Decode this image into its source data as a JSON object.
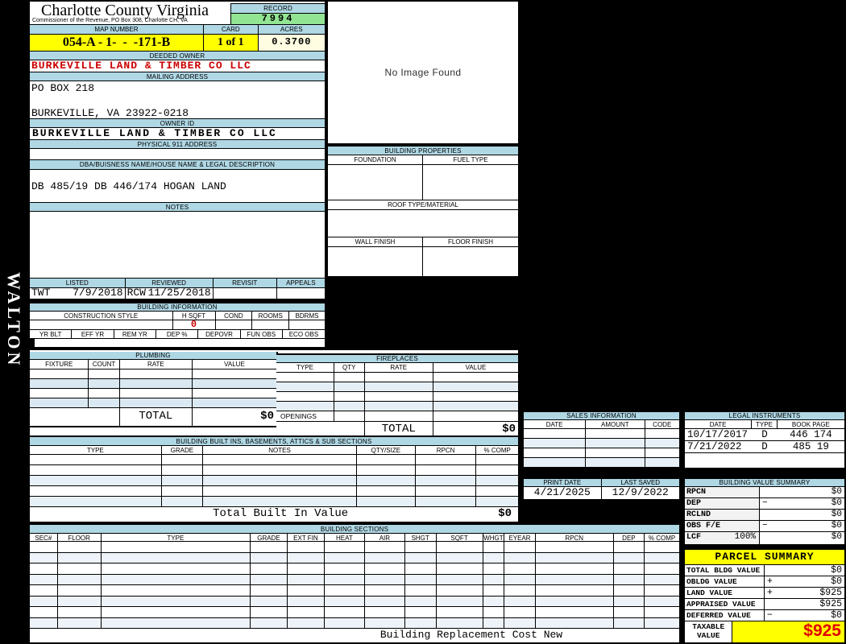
{
  "watermark": {
    "district": "WALTON"
  },
  "header": {
    "title": "Charlotte County Virginia",
    "subtitle": "Commissioner of the Revenue, PO Box 308, Charlotte CH, VA",
    "record_label": "RECORD",
    "record_value": "7994",
    "map_number_label": "MAP NUMBER",
    "map_number": "054-A - 1-  -  -171-B",
    "card_label": "CARD",
    "card_value": "1 of 1",
    "acres_label": "ACRES",
    "acres_value": "0.3700"
  },
  "owner": {
    "deeded_owner_label": "DEEDED OWNER",
    "deeded_owner": "BURKEVILLE LAND & TIMBER CO LLC",
    "mailing_address_label": "MAILING ADDRESS",
    "mailing_line1": "PO BOX 218",
    "mailing_line2": "BURKEVILLE, VA 23922-0218",
    "owner_id_label": "OWNER ID",
    "owner_id": "BURKEVILLE LAND & TIMBER CO LLC",
    "physical_address_label": "PHYSICAL 911 ADDRESS"
  },
  "description": {
    "dba_label": "DBA/BUISNESS NAME/HOUSE NAME & LEGAL DESCRIPTION",
    "legal_text": "DB 485/19 DB 446/174 HOGAN LAND",
    "notes_label": "NOTES"
  },
  "image_panel": {
    "placeholder": "No Image Found"
  },
  "building_properties": {
    "title": "BUILDING PROPERTIES",
    "foundation_label": "FOUNDATION",
    "fuel_label": "FUEL TYPE",
    "roof_label": "ROOF TYPE/MATERIAL",
    "wall_label": "WALL FINISH",
    "floor_label": "FLOOR FINISH"
  },
  "review": {
    "listed_label": "LISTED",
    "listed_by": "TWT",
    "listed_date": "7/9/2018",
    "reviewed_label": "REVIEWED",
    "reviewed_by": "RCW",
    "reviewed_date": "11/25/2018",
    "revisit_label": "REVISIT",
    "appeals_label": "APPEALS"
  },
  "building_information": {
    "title": "BUILDING INFORMATION",
    "row1_columns": [
      "CONSTRUCTION STYLE",
      "H SQFT",
      "COND",
      "ROOMS",
      "BDRMS"
    ],
    "h_sqft_value": "0",
    "row2_columns": [
      "YR BLT",
      "EFF YR",
      "REM YR",
      "DEP %",
      "DEPOVR",
      "FUN OBS",
      "ECO OBS"
    ]
  },
  "plumbing": {
    "title": "PLUMBING",
    "columns": [
      "FIXTURE",
      "COUNT",
      "RATE",
      "VALUE"
    ],
    "total_label": "TOTAL",
    "total_value": "$0"
  },
  "fireplaces": {
    "title": "FIREPLACES",
    "columns": [
      "TYPE",
      "QTY",
      "RATE",
      "VALUE"
    ],
    "openings_label": "OPENINGS",
    "total_label": "TOTAL",
    "total_value": "$0"
  },
  "built_ins": {
    "title": "BUILDING BUILT INS, BASEMENTS, ATTICS & SUB SECTIONS",
    "columns": [
      "TYPE",
      "GRADE",
      "NOTES",
      "QTY/SIZE",
      "RPCN",
      "% COMP"
    ],
    "total_label": "Total Built In Value",
    "total_value": "$0"
  },
  "building_sections": {
    "title": "BUILDING SECTIONS",
    "columns": [
      "SEC#",
      "FLOOR",
      "TYPE",
      "GRADE",
      "EXT FIN",
      "HEAT",
      "AIR",
      "SHGT",
      "SQFT",
      "WHGT",
      "EYEAR",
      "RPCN",
      "DEP",
      "% COMP"
    ],
    "footer_label": "Building Replacement Cost New"
  },
  "sales": {
    "title": "SALES INFORMATION",
    "columns": [
      "DATE",
      "AMOUNT",
      "CODE"
    ]
  },
  "legal_instruments": {
    "title": "LEGAL INSTRUMENTS",
    "columns": [
      "DATE",
      "TYPE",
      "BOOK PAGE"
    ],
    "rows": [
      {
        "date": "10/17/2017",
        "type": "D",
        "book_page": "446 174"
      },
      {
        "date": "7/21/2022",
        "type": "D",
        "book_page": "485 19"
      }
    ]
  },
  "print_info": {
    "print_date_label": "PRINT DATE",
    "print_date": "4/21/2025",
    "last_saved_label": "LAST SAVED",
    "last_saved": "12/9/2022"
  },
  "value_summary": {
    "title": "BUILDING VALUE SUMMARY",
    "rows": [
      {
        "label": "RPCN",
        "pct": "",
        "op": "",
        "value": "$0"
      },
      {
        "label": "DEP",
        "pct": "",
        "op": "−",
        "value": "$0"
      },
      {
        "label": "RCLND",
        "pct": "",
        "op": "",
        "value": "$0"
      },
      {
        "label": "OBS F/E",
        "pct": "",
        "op": "−",
        "value": "$0"
      },
      {
        "label": "LCF",
        "pct": "100%",
        "op": "",
        "value": "$0"
      }
    ]
  },
  "parcel_summary": {
    "title": "PARCEL SUMMARY",
    "rows": [
      {
        "label": "TOTAL BLDG VALUE",
        "op": "",
        "value": "$0"
      },
      {
        "label": "OBLDG VALUE",
        "op": "+",
        "value": "$0"
      },
      {
        "label": "LAND VALUE",
        "op": "+",
        "value": "$925"
      },
      {
        "label": "APPRAISED VALUE",
        "op": "",
        "value": "$925"
      },
      {
        "label": "DEFERRED VALUE",
        "op": "−",
        "value": "$0"
      }
    ],
    "taxable_label_line1": "TAXABLE",
    "taxable_label_line2": "VALUE",
    "taxable_value": "$925"
  },
  "colors": {
    "header_blue": "#AFD7E4",
    "record_green": "#92E592",
    "highlight_yellow": "#FFFF00",
    "acres_cream": "#FEFCE1",
    "owner_red": "#CC0000",
    "taxable_red": "#E00000"
  }
}
